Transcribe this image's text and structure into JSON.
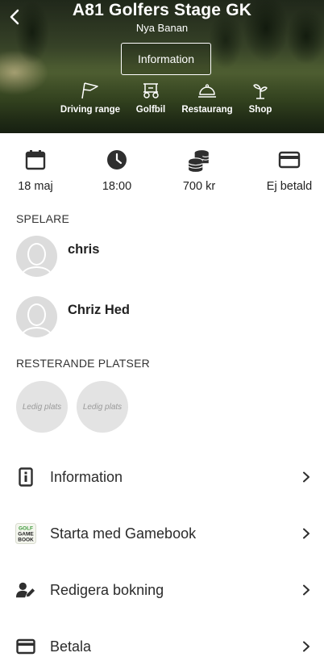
{
  "header": {
    "title": "A81 Golfers Stage GK",
    "subtitle": "Nya Banan",
    "info_button": "Information",
    "amenities": [
      {
        "label": "Driving range",
        "icon": "flag-icon"
      },
      {
        "label": "Golfbil",
        "icon": "golf-cart-icon"
      },
      {
        "label": "Restaurang",
        "icon": "cloche-icon"
      },
      {
        "label": "Shop",
        "icon": "shop-icon"
      }
    ]
  },
  "stats": {
    "date": "18 maj",
    "time": "18:00",
    "price": "700 kr",
    "payment": "Ej betald"
  },
  "players": {
    "label": "SPELARE",
    "items": [
      {
        "name": "chris"
      },
      {
        "name": "Chriz Hed"
      }
    ]
  },
  "remaining": {
    "label": "RESTERANDE PLATSER",
    "slots": [
      "Ledig plats",
      "Ledig plats"
    ]
  },
  "menu": [
    {
      "label": "Information",
      "icon": "info-icon"
    },
    {
      "label": "Starta med Gamebook",
      "icon": "golf-gamebook-logo"
    },
    {
      "label": "Redigera bokning",
      "icon": "edit-user-icon"
    },
    {
      "label": "Betala",
      "icon": "card-icon"
    }
  ],
  "logo_text": {
    "line1": "GOLF",
    "line2": "GAME",
    "line3": "BOOK"
  },
  "colors": {
    "icon_dark": "#2f2f2f",
    "slot_bg": "#e3e3e3",
    "avatar_bg": "#dcdcdc"
  }
}
